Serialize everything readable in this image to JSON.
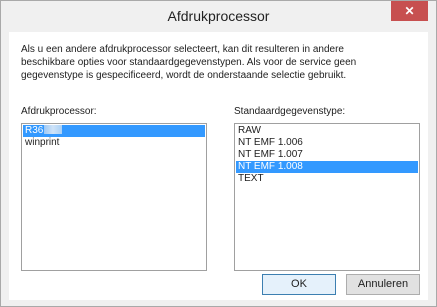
{
  "window": {
    "title": "Afdrukprocessor",
    "close_glyph": "✕"
  },
  "description": [
    "Als u een andere afdrukprocessor selecteert, kan dit resulteren in andere",
    "beschikbare opties voor standaardgegevenstypen. Als voor de service geen",
    "gegevenstype is gespecificeerd, wordt de onderstaande selectie gebruikt."
  ],
  "processors": {
    "label": "Afdrukprocessor:",
    "items": [
      "R36",
      "winprint"
    ],
    "selected_index": 0
  },
  "datatypes": {
    "label": "Standaardgegevenstype:",
    "items": [
      "RAW",
      "NT EMF 1.006",
      "NT EMF 1.007",
      "NT EMF 1.008",
      "TEXT"
    ],
    "selected_index": 3
  },
  "buttons": {
    "ok": "OK",
    "cancel": "Annuleren"
  },
  "colors": {
    "selection": "#3399ff",
    "close_button": "#c75050"
  }
}
